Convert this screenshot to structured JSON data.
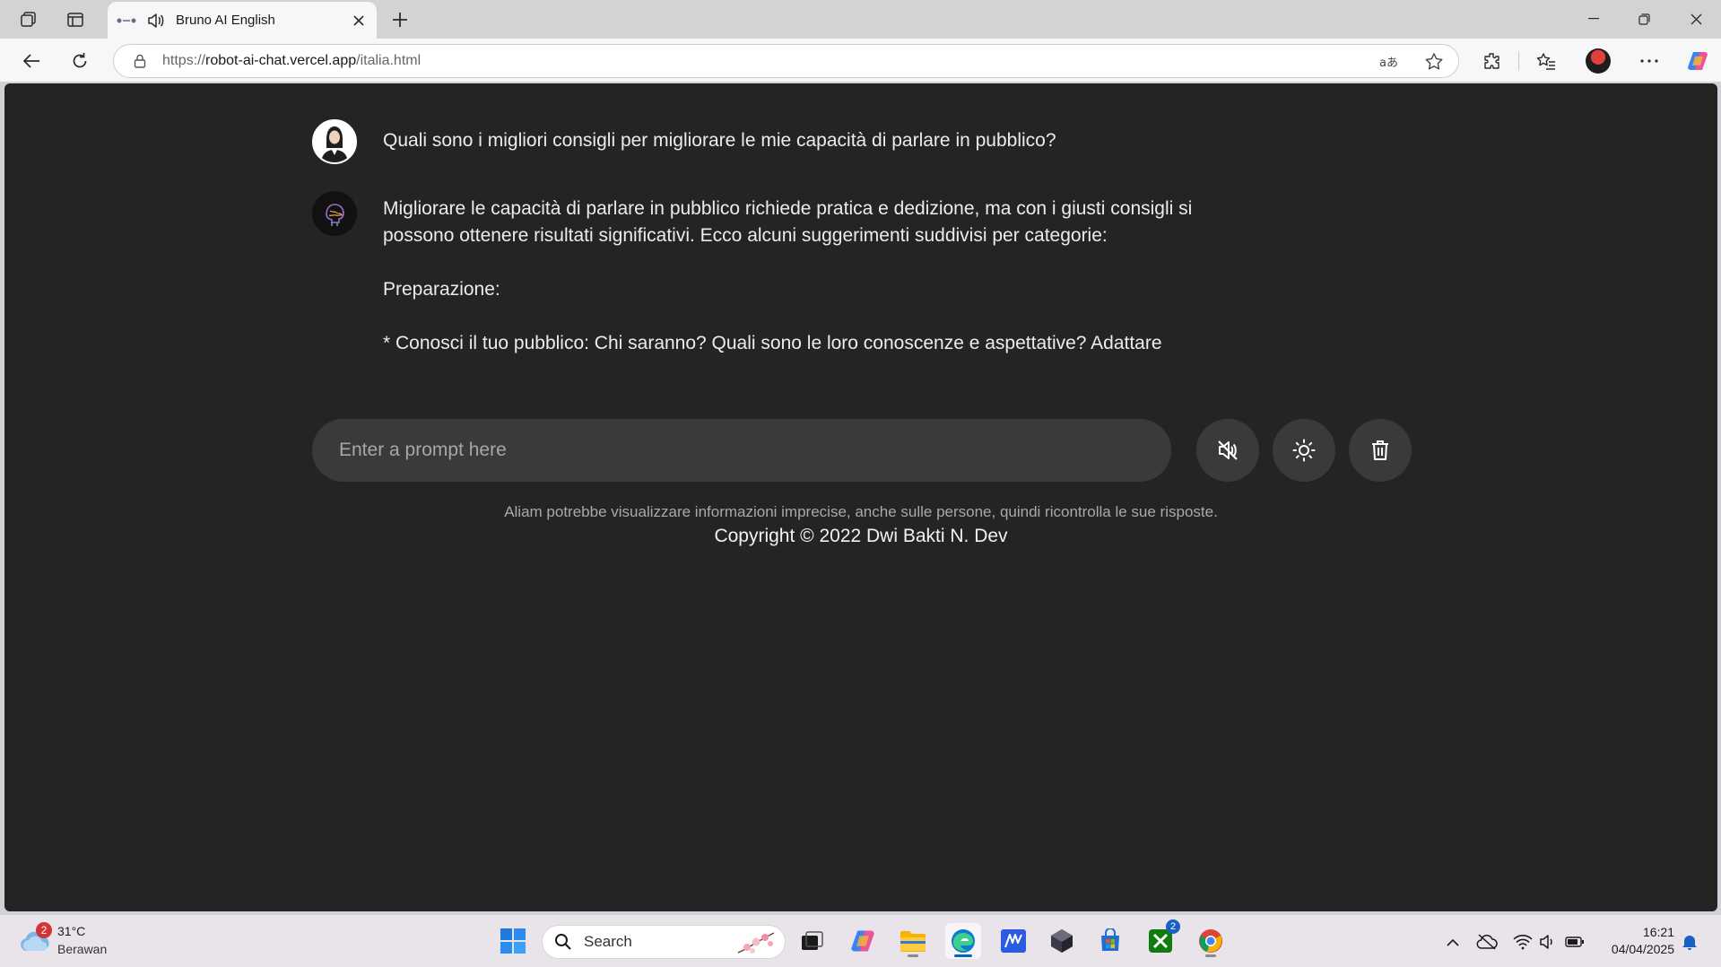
{
  "browser": {
    "tab_title": "Bruno AI English",
    "url_prefix": "https://",
    "url_domain": "robot-ai-chat.vercel.app",
    "url_path": "/italia.html"
  },
  "chat": {
    "user_message": "Quali sono i migliori consigli per migliorare le mie capacità di parlare in pubblico?",
    "bot_paragraphs": [
      "Migliorare le capacità di parlare in pubblico richiede pratica e dedizione, ma con i giusti consigli si possono ottenere risultati significativi. Ecco alcuni suggerimenti suddivisi per categorie:",
      "Preparazione:",
      "* Conosci il tuo pubblico: Chi saranno? Quali sono le loro conoscenze e aspettative? Adattare"
    ]
  },
  "prompt": {
    "placeholder": "Enter a prompt here"
  },
  "footer": {
    "disclaimer": "Aliam potrebbe visualizzare informazioni imprecise, anche sulle persone, quindi ricontrolla le sue risposte.",
    "copyright": "Copyright © 2022 Dwi Bakti N. Dev"
  },
  "taskbar": {
    "weather_badge": "2",
    "temperature": "31°C",
    "condition": "Berawan",
    "search_label": "Search",
    "xbox_badge": "2",
    "time": "16:21",
    "date": "04/04/2025"
  },
  "colors": {
    "page_bg": "#242424",
    "input_bg": "#3a3a3a",
    "accent": "#0067c0"
  }
}
